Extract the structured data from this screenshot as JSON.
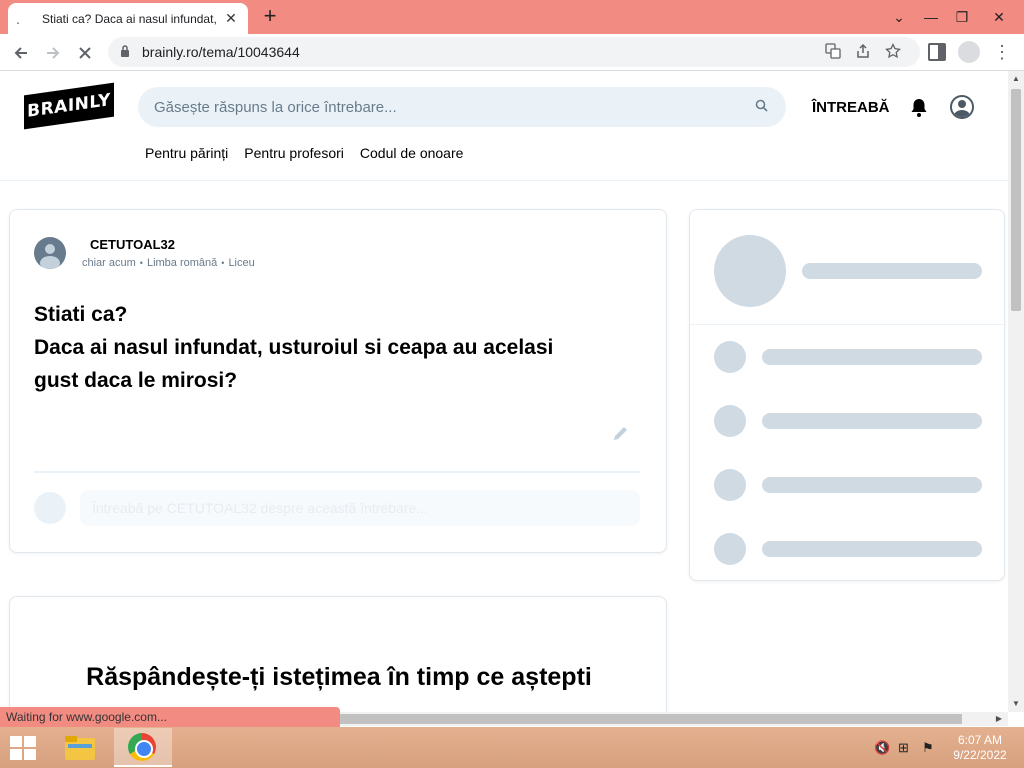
{
  "browser": {
    "tab_title": "Stiati ca? Daca ai nasul infundat,",
    "tab_loading_glyph": ".",
    "tab_close": "✕",
    "new_tab": "+",
    "url": "brainly.ro/tema/10043644",
    "window_controls": {
      "chevron": "⌄",
      "minimize": "—",
      "restore": "❐",
      "close": "✕"
    },
    "status_text": "Waiting for www.google.com..."
  },
  "site": {
    "logo": "BRAINLY",
    "search_placeholder": "Găsește răspuns la orice întrebare...",
    "ask_label": "ÎNTREABĂ",
    "subnav": [
      "Pentru părinți",
      "Pentru profesori",
      "Codul de onoare"
    ]
  },
  "question": {
    "username": "CETUTOAL32",
    "time": "chiar acum",
    "subject": "Limba română",
    "level": "Liceu",
    "lines": [
      "Stiati ca?",
      "Daca ai nasul infundat, usturoiul si ceapa au acelasi",
      "gust daca le mirosi?"
    ],
    "comment_placeholder": "Întreabă pe CETUTOAL32 despre această întrebare..."
  },
  "spread": {
    "title": "Răspândește-ți istețimea în timp ce aștepti"
  },
  "taskbar": {
    "time": "6:07 AM",
    "date": "9/22/2022"
  },
  "icons": {
    "back": "arrow-left-icon",
    "forward": "arrow-right-icon",
    "stop": "close-icon",
    "lock": "lock-icon",
    "translate": "translate-icon",
    "share": "share-icon",
    "star": "star-icon",
    "search": "search-icon",
    "bell": "bell-icon",
    "edit": "pencil-icon"
  },
  "colors": {
    "chrome_accent": "#f28b82",
    "search_bg": "#ebf2f7",
    "skeleton": "#d0dae3",
    "muted_text": "#687b8c"
  }
}
